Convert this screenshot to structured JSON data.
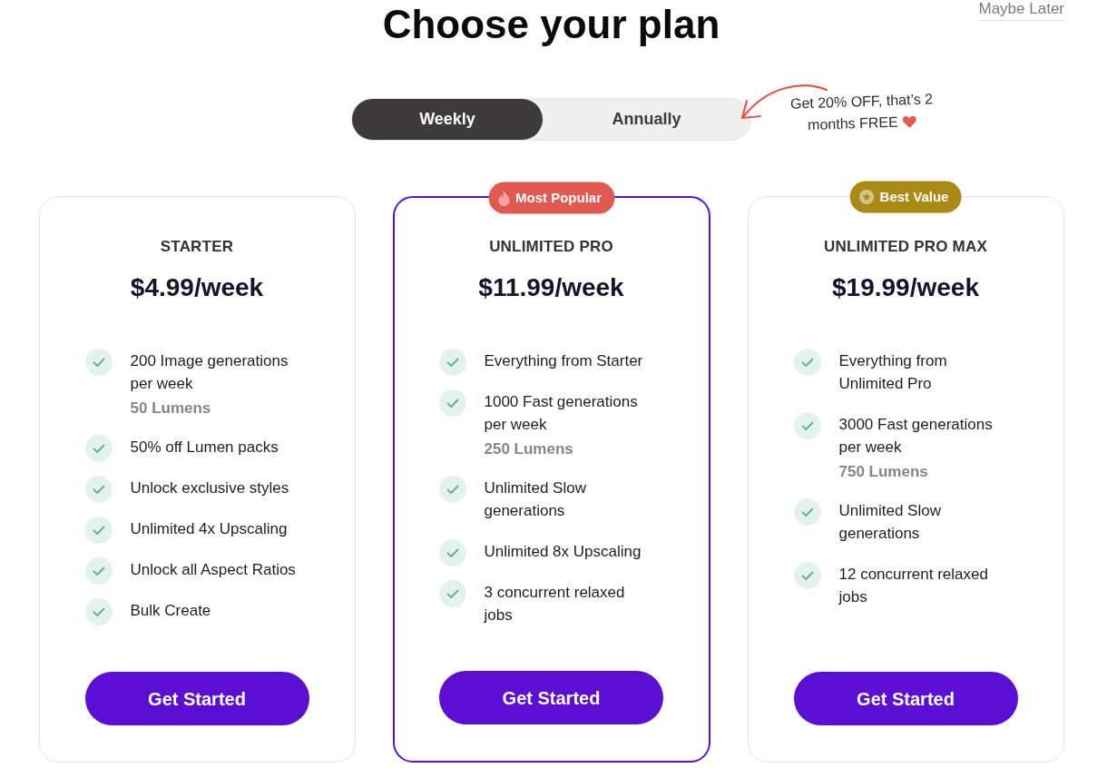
{
  "header": {
    "title": "Choose your plan",
    "dismiss_link": "Maybe Later"
  },
  "billing_tabs": [
    {
      "label": "Weekly",
      "selected": true
    },
    {
      "label": "Annually",
      "selected": false
    }
  ],
  "promo_note": [
    "Get 20% OFF, that’s 2",
    "months FREE"
  ],
  "plans": [
    {
      "name": "STARTER",
      "price": "$4.99/week",
      "highlighted": false,
      "features": [
        {
          "text": "200 Image generations per week",
          "note": "50 Lumens"
        },
        {
          "text": "50% off Lumen packs"
        },
        {
          "text": "Unlock exclusive styles"
        },
        {
          "text": "Unlimited 4x Upscaling"
        },
        {
          "text": "Unlock all Aspect Ratios"
        },
        {
          "text": "Bulk Create"
        }
      ],
      "button": "Get Started"
    },
    {
      "badge": {
        "kind": "popular",
        "text": "Most Popular",
        "color": "#e05a52"
      },
      "name": "UNLIMITED PRO",
      "price": "$11.99/week",
      "highlighted": true,
      "features": [
        {
          "text": "Everything from Starter"
        },
        {
          "text": "1000 Fast generations per week",
          "note": "250 Lumens"
        },
        {
          "text": "Unlimited Slow generations"
        },
        {
          "text": "Unlimited 8x Upscaling"
        },
        {
          "text": "3 concurrent relaxed jobs"
        }
      ],
      "button": "Get Started"
    },
    {
      "badge": {
        "kind": "value",
        "text": "Best Value",
        "color": "#a98a14"
      },
      "name": "UNLIMITED PRO MAX",
      "price": "$19.99/week",
      "highlighted": false,
      "features": [
        {
          "text": "Everything from Unlimited Pro"
        },
        {
          "text": "3000 Fast generations per week",
          "note": "750 Lumens"
        },
        {
          "text": "Unlimited Slow generations"
        },
        {
          "text": "12 concurrent relaxed jobs"
        }
      ],
      "button": "Get Started"
    }
  ]
}
